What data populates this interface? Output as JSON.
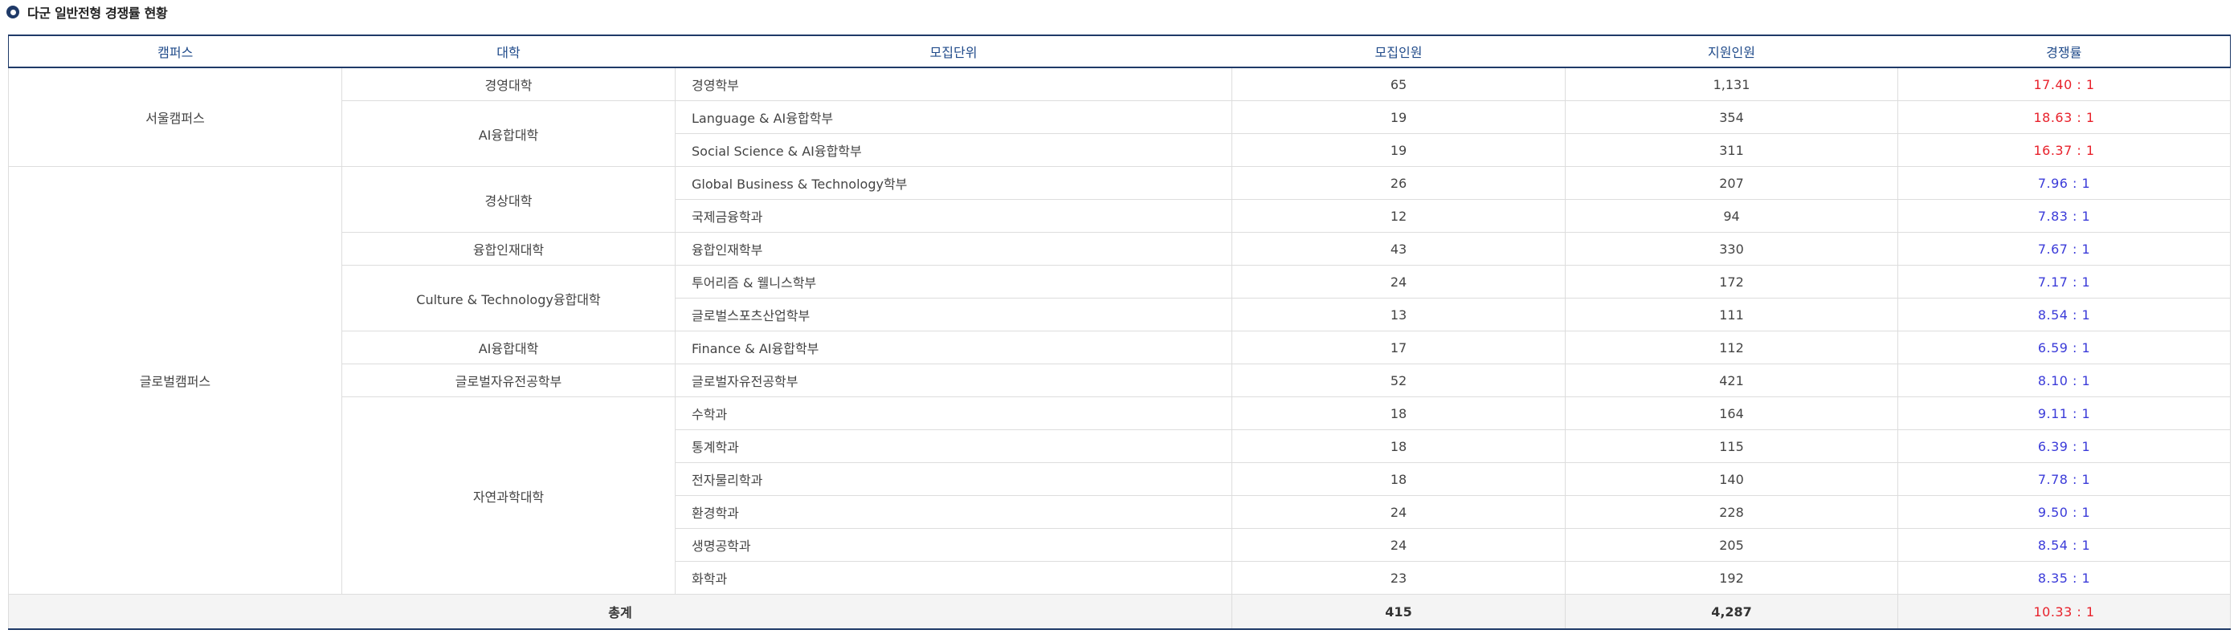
{
  "heading": {
    "bullet_icon": "circle-bullet-icon",
    "title": "다군 일반전형 경쟁률 현황"
  },
  "colors": {
    "header_line": "#1f3a68",
    "header_text": "#1f4a8a",
    "ratio_high": "#e8212b",
    "ratio_low": "#3b3bd9",
    "total_bg": "#f4f4f4"
  },
  "table": {
    "headers": [
      "캠퍼스",
      "대학",
      "모집단위",
      "모집인원",
      "지원인원",
      "경쟁률"
    ],
    "campuses": [
      {
        "name": "서울캠퍼스",
        "colleges": [
          {
            "name": "경영대학",
            "units": [
              {
                "unit": "경영학부",
                "quota": "65",
                "applicants": "1,131",
                "ratio": "17.40 : 1",
                "tone": "high"
              }
            ]
          },
          {
            "name": "AI융합대학",
            "units": [
              {
                "unit": "Language & AI융합학부",
                "quota": "19",
                "applicants": "354",
                "ratio": "18.63 : 1",
                "tone": "high"
              },
              {
                "unit": "Social Science & AI융합학부",
                "quota": "19",
                "applicants": "311",
                "ratio": "16.37 : 1",
                "tone": "high"
              }
            ]
          }
        ]
      },
      {
        "name": "글로벌캠퍼스",
        "colleges": [
          {
            "name": "경상대학",
            "units": [
              {
                "unit": "Global Business & Technology학부",
                "quota": "26",
                "applicants": "207",
                "ratio": "7.96 : 1",
                "tone": "low"
              },
              {
                "unit": "국제금융학과",
                "quota": "12",
                "applicants": "94",
                "ratio": "7.83 : 1",
                "tone": "low"
              }
            ]
          },
          {
            "name": "융합인재대학",
            "units": [
              {
                "unit": "융합인재학부",
                "quota": "43",
                "applicants": "330",
                "ratio": "7.67 : 1",
                "tone": "low"
              }
            ]
          },
          {
            "name": "Culture & Technology융합대학",
            "units": [
              {
                "unit": "투어리즘 & 웰니스학부",
                "quota": "24",
                "applicants": "172",
                "ratio": "7.17 : 1",
                "tone": "low"
              },
              {
                "unit": "글로벌스포츠산업학부",
                "quota": "13",
                "applicants": "111",
                "ratio": "8.54 : 1",
                "tone": "low"
              }
            ]
          },
          {
            "name": "AI융합대학",
            "units": [
              {
                "unit": "Finance & AI융합학부",
                "quota": "17",
                "applicants": "112",
                "ratio": "6.59 : 1",
                "tone": "low"
              }
            ]
          },
          {
            "name": "글로벌자유전공학부",
            "units": [
              {
                "unit": "글로벌자유전공학부",
                "quota": "52",
                "applicants": "421",
                "ratio": "8.10 : 1",
                "tone": "low"
              }
            ]
          },
          {
            "name": "자연과학대학",
            "units": [
              {
                "unit": "수학과",
                "quota": "18",
                "applicants": "164",
                "ratio": "9.11 : 1",
                "tone": "low"
              },
              {
                "unit": "통계학과",
                "quota": "18",
                "applicants": "115",
                "ratio": "6.39 : 1",
                "tone": "low"
              },
              {
                "unit": "전자물리학과",
                "quota": "18",
                "applicants": "140",
                "ratio": "7.78 : 1",
                "tone": "low"
              },
              {
                "unit": "환경학과",
                "quota": "24",
                "applicants": "228",
                "ratio": "9.50 : 1",
                "tone": "low"
              },
              {
                "unit": "생명공학과",
                "quota": "24",
                "applicants": "205",
                "ratio": "8.54 : 1",
                "tone": "low"
              },
              {
                "unit": "화학과",
                "quota": "23",
                "applicants": "192",
                "ratio": "8.35 : 1",
                "tone": "low"
              }
            ]
          }
        ]
      }
    ],
    "total": {
      "label": "총계",
      "quota": "415",
      "applicants": "4,287",
      "ratio": "10.33 : 1",
      "tone": "high"
    }
  }
}
